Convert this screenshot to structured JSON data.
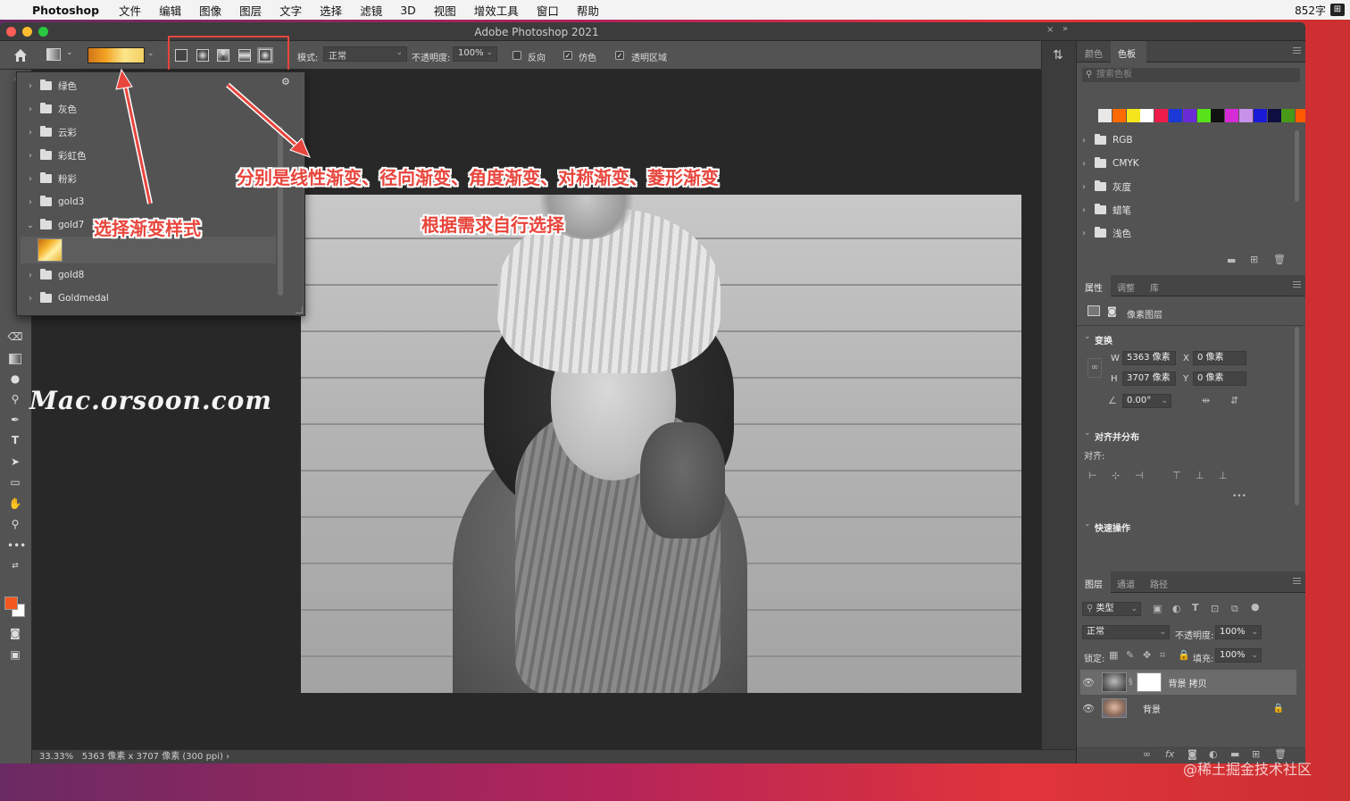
{
  "menubar": {
    "app": "Photoshop",
    "items": [
      "文件",
      "编辑",
      "图像",
      "图层",
      "文字",
      "选择",
      "滤镜",
      "3D",
      "视图",
      "增效工具",
      "窗口",
      "帮助"
    ],
    "right_text": "852字",
    "right_icon": "input-method-icon"
  },
  "window": {
    "title": "Adobe Photoshop 2021"
  },
  "options": {
    "mode_label": "模式:",
    "mode_value": "正常",
    "opacity_label": "不透明度:",
    "opacity_value": "100%",
    "reverse_label": "反向",
    "reverse_checked": false,
    "dither_label": "仿色",
    "dither_checked": true,
    "transparency_label": "透明区域",
    "transparency_checked": true,
    "gradient_types": [
      "linear-gradient-icon",
      "radial-gradient-icon",
      "angle-gradient-icon",
      "reflected-gradient-icon",
      "diamond-gradient-icon"
    ]
  },
  "gradient_panel": {
    "folders": [
      {
        "name": "绿色",
        "expanded": false
      },
      {
        "name": "灰色",
        "expanded": false
      },
      {
        "name": "云彩",
        "expanded": false
      },
      {
        "name": "彩虹色",
        "expanded": false
      },
      {
        "name": "粉彩",
        "expanded": false
      },
      {
        "name": "gold3",
        "expanded": false
      },
      {
        "name": "gold7",
        "expanded": true
      },
      {
        "name": "gold8",
        "expanded": false
      },
      {
        "name": "Goldmedal",
        "expanded": false
      }
    ]
  },
  "annotations": {
    "select_style": "选择渐变样式",
    "types_desc": "分别是线性渐变、径向渐变、角度渐变、对称渐变、菱形渐变",
    "choose": "根据需求自行选择",
    "watermark": "Mac.orsoon.com"
  },
  "status": {
    "zoom": "33.33%",
    "info": "5363 像素 x 3707 像素 (300 ppi)",
    "arrow": "›"
  },
  "swatches_panel": {
    "tabs": [
      "颜色",
      "色板"
    ],
    "active_tab": "色板",
    "search_placeholder": "搜索色板",
    "colors": [
      "#e8e8e8",
      "#ff6a00",
      "#f5e51d",
      "#ffffff",
      "#ee1c4a",
      "#1c38d6",
      "#6a2bd6",
      "#58e21c",
      "#111111",
      "#d62bd6",
      "#c792e8",
      "#1a1ad6",
      "#0e0e40",
      "#4a9a1a",
      "#ff5a00"
    ],
    "folders": [
      "RGB",
      "CMYK",
      "灰度",
      "蜡笔",
      "浅色"
    ]
  },
  "properties_panel": {
    "tabs": [
      "属性",
      "调整",
      "库"
    ],
    "active_tab": "属性",
    "layer_type": "像素图层",
    "transform_label": "变换",
    "w_label": "W",
    "w_value": "5363 像素",
    "h_label": "H",
    "h_value": "3707 像素",
    "x_label": "X",
    "x_value": "0 像素",
    "y_label": "Y",
    "y_value": "0 像素",
    "angle_value": "0.00°",
    "align_section": "对齐并分布",
    "align_label": "对齐:",
    "more": "•••",
    "quick_actions": "快速操作"
  },
  "layers_panel": {
    "tabs": [
      "图层",
      "通道",
      "路径"
    ],
    "active_tab": "图层",
    "filter_label": "类型",
    "blend_mode": "正常",
    "opacity_label": "不透明度:",
    "opacity_value": "100%",
    "lock_label": "锁定:",
    "fill_label": "填充:",
    "fill_value": "100%",
    "layers": [
      {
        "name": "背景 拷贝",
        "selected": true,
        "has_mask": true,
        "locked": false
      },
      {
        "name": "背景",
        "selected": false,
        "has_mask": false,
        "locked": true
      }
    ]
  },
  "credit": "@稀土掘金技术社区",
  "colors": {
    "accent_red": "#e8453c",
    "foreground": "#f4581e",
    "background": "#ffffff"
  }
}
